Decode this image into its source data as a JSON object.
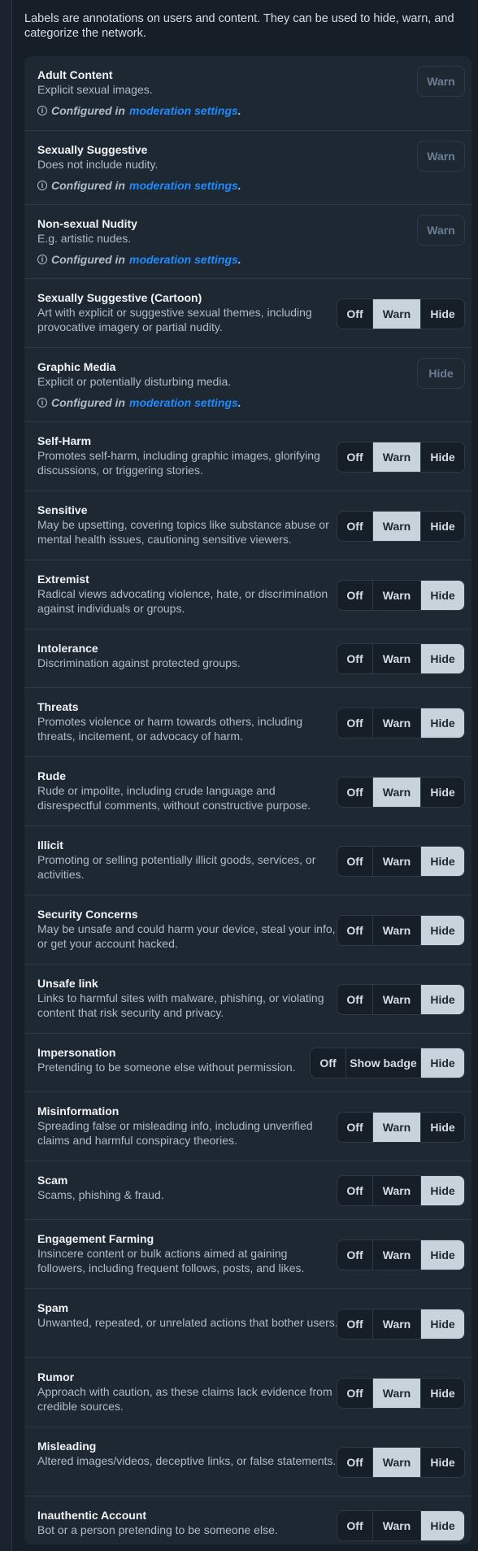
{
  "intro": "Labels are annotations on users and content. They can be used to hide, warn, and categorize the network.",
  "configured_prefix": "Configured in",
  "configured_link": "moderation settings",
  "configured_suffix": ".",
  "labels": [
    {
      "title": "Adult Content",
      "desc": "Explicit sexual images.",
      "configured": true,
      "button": "Warn"
    },
    {
      "title": "Sexually Suggestive",
      "desc": "Does not include nudity.",
      "configured": true,
      "button": "Warn"
    },
    {
      "title": "Non-sexual Nudity",
      "desc": "E.g. artistic nudes.",
      "configured": true,
      "button": "Warn"
    },
    {
      "title": "Sexually Suggestive (Cartoon)",
      "desc": "Art with explicit or suggestive sexual themes, including provocative imagery or partial nudity.",
      "options": [
        "Off",
        "Warn",
        "Hide"
      ],
      "selected": "Warn"
    },
    {
      "title": "Graphic Media",
      "desc": "Explicit or potentially disturbing media.",
      "configured": true,
      "button": "Hide"
    },
    {
      "title": "Self-Harm",
      "desc": "Promotes self-harm, including graphic images, glorifying discussions, or triggering stories.",
      "options": [
        "Off",
        "Warn",
        "Hide"
      ],
      "selected": "Warn"
    },
    {
      "title": "Sensitive",
      "desc": "May be upsetting, covering topics like substance abuse or mental health issues, cautioning sensitive viewers.",
      "options": [
        "Off",
        "Warn",
        "Hide"
      ],
      "selected": "Warn"
    },
    {
      "title": "Extremist",
      "desc": "Radical views advocating violence, hate, or discrimination against individuals or groups.",
      "options": [
        "Off",
        "Warn",
        "Hide"
      ],
      "selected": "Hide"
    },
    {
      "title": "Intolerance",
      "desc": "Discrimination against protected groups.",
      "options": [
        "Off",
        "Warn",
        "Hide"
      ],
      "selected": "Hide"
    },
    {
      "title": "Threats",
      "desc": "Promotes violence or harm towards others, including threats, incitement, or advocacy of harm.",
      "options": [
        "Off",
        "Warn",
        "Hide"
      ],
      "selected": "Hide"
    },
    {
      "title": "Rude",
      "desc": "Rude or impolite, including crude language and disrespectful comments, without constructive purpose.",
      "options": [
        "Off",
        "Warn",
        "Hide"
      ],
      "selected": "Warn"
    },
    {
      "title": "Illicit",
      "desc": "Promoting or selling potentially illicit goods, services, or activities.",
      "options": [
        "Off",
        "Warn",
        "Hide"
      ],
      "selected": "Hide"
    },
    {
      "title": "Security Concerns",
      "desc": "May be unsafe and could harm your device, steal your info, or get your account hacked.",
      "options": [
        "Off",
        "Warn",
        "Hide"
      ],
      "selected": "Hide"
    },
    {
      "title": "Unsafe link",
      "desc": "Links to harmful sites with malware, phishing, or violating content that risk security and privacy.",
      "options": [
        "Off",
        "Warn",
        "Hide"
      ],
      "selected": "Hide"
    },
    {
      "title": "Impersonation",
      "desc": "Pretending to be someone else without permission.",
      "options": [
        "Off",
        "Show badge",
        "Hide"
      ],
      "selected": "Hide"
    },
    {
      "title": "Misinformation",
      "desc": "Spreading false or misleading info, including unverified claims and harmful conspiracy theories.",
      "options": [
        "Off",
        "Warn",
        "Hide"
      ],
      "selected": "Warn"
    },
    {
      "title": "Scam",
      "desc": "Scams, phishing & fraud.",
      "options": [
        "Off",
        "Warn",
        "Hide"
      ],
      "selected": "Hide"
    },
    {
      "title": "Engagement Farming",
      "desc": "Insincere content or bulk actions aimed at gaining followers, including frequent follows, posts, and likes.",
      "options": [
        "Off",
        "Warn",
        "Hide"
      ],
      "selected": "Hide"
    },
    {
      "title": "Spam",
      "desc": "Unwanted, repeated, or unrelated actions that bother users.",
      "options": [
        "Off",
        "Warn",
        "Hide"
      ],
      "selected": "Hide"
    },
    {
      "title": "Rumor",
      "desc": "Approach with caution, as these claims lack evidence from credible sources.",
      "options": [
        "Off",
        "Warn",
        "Hide"
      ],
      "selected": "Warn"
    },
    {
      "title": "Misleading",
      "desc": "Altered images/videos, deceptive links, or false statements.",
      "options": [
        "Off",
        "Warn",
        "Hide"
      ],
      "selected": "Warn"
    },
    {
      "title": "Inauthentic Account",
      "desc": "Bot or a person pretending to be someone else.",
      "options": [
        "Off",
        "Warn",
        "Hide"
      ],
      "selected": "Hide"
    }
  ]
}
